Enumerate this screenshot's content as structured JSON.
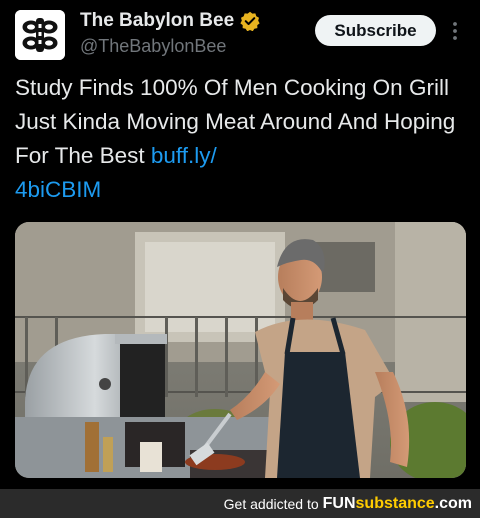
{
  "account": {
    "display_name": "The Babylon Bee",
    "handle": "@TheBabylonBee",
    "verified": true,
    "verified_badge_color": "#e8b320",
    "avatar_icon": "bee-logo-icon"
  },
  "actions": {
    "subscribe_label": "Subscribe",
    "more_icon": "more-options-icon"
  },
  "tweet": {
    "text": "Study Finds 100% Of Men Cooking On Grill Just Kinda Moving Meat Around And Hoping For The Best ",
    "link_text": "buff.ly/\n4biCBIM",
    "link_color": "#1d9bf0"
  },
  "media": {
    "type": "photo",
    "subject": "man-grilling-photo"
  },
  "footer": {
    "prefix": "Get addicted to",
    "brand_part1": "FUN",
    "brand_part2": "substance",
    "brand_part3": ".com",
    "brand_accent": "#ffcc00"
  }
}
